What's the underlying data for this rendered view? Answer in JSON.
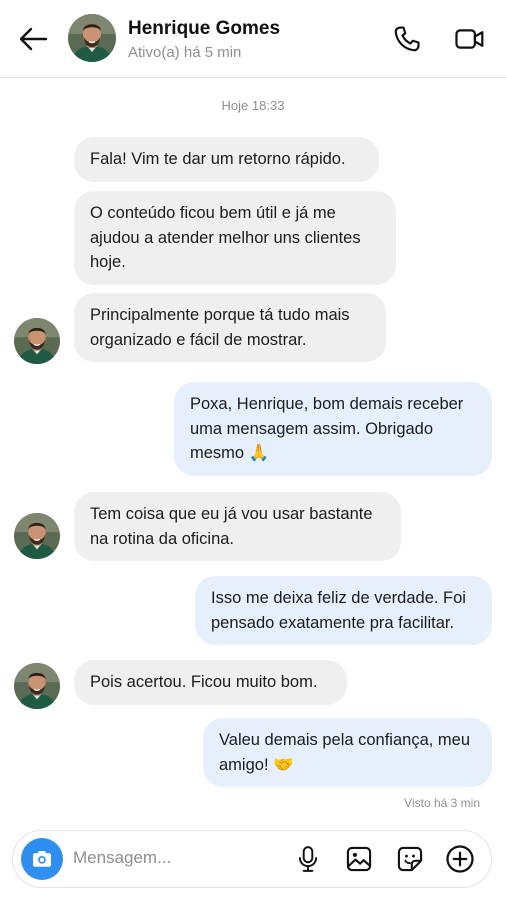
{
  "header": {
    "contact_name": "Henrique Gomes",
    "status": "Ativo(a) há 5 min",
    "icons": [
      "back-arrow-icon",
      "phone-icon",
      "video-camera-icon"
    ]
  },
  "date_separator": "Hoje 18:33",
  "messages": [
    {
      "from": "contact",
      "text": "Fala! Vim te dar um retorno rápido."
    },
    {
      "from": "contact",
      "text": "O conteúdo ficou bem útil e já me ajudou a atender melhor uns clientes hoje."
    },
    {
      "from": "contact",
      "text": "Principalmente porque tá tudo mais organizado e fácil de mostrar."
    },
    {
      "from": "me",
      "text": "Poxa, Henrique, bom demais receber uma mensagem assim. Obrigado mesmo 🙏"
    },
    {
      "from": "contact",
      "text": "Tem coisa que eu já vou usar bastante na rotina da oficina."
    },
    {
      "from": "me",
      "text": "Isso me deixa feliz de verdade. Foi pensado exatamente pra facilitar."
    },
    {
      "from": "contact",
      "text": "Pois acertou. Ficou muito bom."
    },
    {
      "from": "me",
      "text": "Valeu demais pela confiança, meu amigo! 🤝"
    }
  ],
  "seen_status": "Visto há 3 min",
  "composer": {
    "placeholder": "Mensagem...",
    "value": "",
    "icons": [
      "camera-icon",
      "microphone-icon",
      "gallery-icon",
      "sticker-icon",
      "plus-icon"
    ]
  },
  "colors": {
    "incoming_bubble": "#efefef",
    "outgoing_bubble": "#e5f0fc",
    "accent": "#2f8ff0",
    "muted_text": "#8e8e8e"
  }
}
